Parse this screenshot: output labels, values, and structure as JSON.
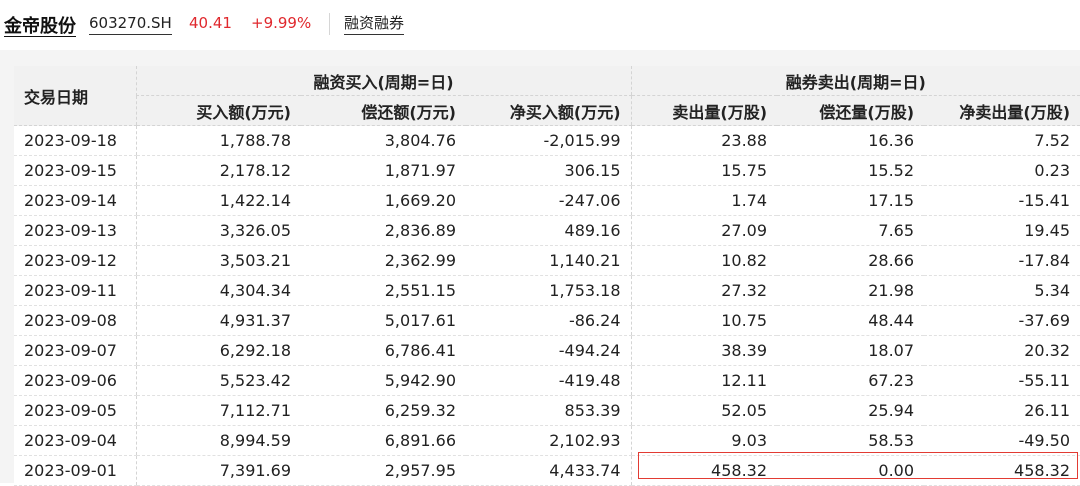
{
  "header": {
    "stock_name": "金帝股份",
    "stock_code": "603270.SH",
    "price": "40.41",
    "change_pct": "+9.99%",
    "margin_link": "融资融券"
  },
  "table": {
    "row_header": "交易日期",
    "group_financing": "融资买入(周期=日)",
    "group_short": "融券卖出(周期=日)",
    "columns": [
      "买入额(万元)",
      "偿还额(万元)",
      "净买入额(万元)",
      "卖出量(万股)",
      "偿还量(万股)",
      "净卖出量(万股)"
    ],
    "rows": [
      {
        "date": "2023-09-18",
        "buy": "1,788.78",
        "repay": "3,804.76",
        "net_buy": "-2,015.99",
        "sell": "23.88",
        "repay_vol": "16.36",
        "net_sell": "7.52"
      },
      {
        "date": "2023-09-15",
        "buy": "2,178.12",
        "repay": "1,871.97",
        "net_buy": "306.15",
        "sell": "15.75",
        "repay_vol": "15.52",
        "net_sell": "0.23"
      },
      {
        "date": "2023-09-14",
        "buy": "1,422.14",
        "repay": "1,669.20",
        "net_buy": "-247.06",
        "sell": "1.74",
        "repay_vol": "17.15",
        "net_sell": "-15.41"
      },
      {
        "date": "2023-09-13",
        "buy": "3,326.05",
        "repay": "2,836.89",
        "net_buy": "489.16",
        "sell": "27.09",
        "repay_vol": "7.65",
        "net_sell": "19.45"
      },
      {
        "date": "2023-09-12",
        "buy": "3,503.21",
        "repay": "2,362.99",
        "net_buy": "1,140.21",
        "sell": "10.82",
        "repay_vol": "28.66",
        "net_sell": "-17.84"
      },
      {
        "date": "2023-09-11",
        "buy": "4,304.34",
        "repay": "2,551.15",
        "net_buy": "1,753.18",
        "sell": "27.32",
        "repay_vol": "21.98",
        "net_sell": "5.34"
      },
      {
        "date": "2023-09-08",
        "buy": "4,931.37",
        "repay": "5,017.61",
        "net_buy": "-86.24",
        "sell": "10.75",
        "repay_vol": "48.44",
        "net_sell": "-37.69"
      },
      {
        "date": "2023-09-07",
        "buy": "6,292.18",
        "repay": "6,786.41",
        "net_buy": "-494.24",
        "sell": "38.39",
        "repay_vol": "18.07",
        "net_sell": "20.32"
      },
      {
        "date": "2023-09-06",
        "buy": "5,523.42",
        "repay": "5,942.90",
        "net_buy": "-419.48",
        "sell": "12.11",
        "repay_vol": "67.23",
        "net_sell": "-55.11"
      },
      {
        "date": "2023-09-05",
        "buy": "7,112.71",
        "repay": "6,259.32",
        "net_buy": "853.39",
        "sell": "52.05",
        "repay_vol": "25.94",
        "net_sell": "26.11"
      },
      {
        "date": "2023-09-04",
        "buy": "8,994.59",
        "repay": "6,891.66",
        "net_buy": "2,102.93",
        "sell": "9.03",
        "repay_vol": "58.53",
        "net_sell": "-49.50"
      },
      {
        "date": "2023-09-01",
        "buy": "7,391.69",
        "repay": "2,957.95",
        "net_buy": "4,433.74",
        "sell": "458.32",
        "repay_vol": "0.00",
        "net_sell": "458.32"
      }
    ]
  },
  "colors": {
    "up": "#e0282d",
    "highlight_border": "#e23b33",
    "header_bg": "#f1f1f1"
  }
}
